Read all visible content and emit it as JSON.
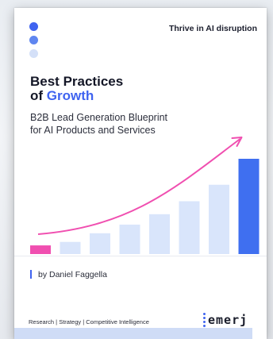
{
  "tagline": "Thrive in AI disruption",
  "title_line1": "Best Practices",
  "title_line2_prefix": "of",
  "title_line2_accent": "Growth",
  "subtitle_line1": "B2B Lead Generation Blueprint",
  "subtitle_line2": "for AI Products and Services",
  "author": "by Daniel Faggella",
  "footer": "Research | Strategy | Competitive Intelligence",
  "logo_text": "emerj",
  "colors": {
    "accent": "#3f63f0",
    "pink": "#f04fb0",
    "bar_light": "#d9e5fb",
    "bar_highlight": "#3f6ff0"
  },
  "chart_data": {
    "type": "bar",
    "values": [
      1,
      1.4,
      2.4,
      3.4,
      4.6,
      6.1,
      8.0,
      11.0
    ],
    "highlight_first": true,
    "highlight_last": true,
    "trend_arrow": true
  }
}
